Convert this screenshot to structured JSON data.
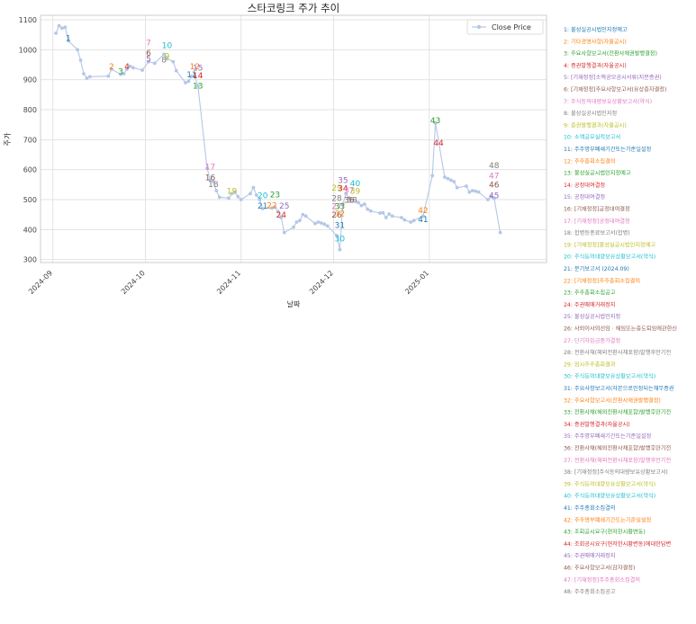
{
  "chart_data": {
    "type": "line",
    "title": "스타코링크 주가 추이",
    "xlabel": "날짜",
    "ylabel": "주가",
    "ylim": [
      290,
      1115
    ],
    "xlim": [
      "2024-08-28",
      "2025-02-08"
    ],
    "yticks": [
      300,
      400,
      500,
      600,
      700,
      800,
      900,
      1000,
      1100
    ],
    "xticks": [
      {
        "date": "2024-09-01",
        "label": "2024-09"
      },
      {
        "date": "2024-10-01",
        "label": "2024-10"
      },
      {
        "date": "2024-11-01",
        "label": "2024-11"
      },
      {
        "date": "2024-12-01",
        "label": "2024-12"
      },
      {
        "date": "2025-01-01",
        "label": "2025-01"
      }
    ],
    "grid": true,
    "legend": "top-right",
    "series": [
      {
        "name": "Close Price",
        "color": "#b4c7e7",
        "points": [
          [
            "2024-09-02",
            1055
          ],
          [
            "2024-09-03",
            1080
          ],
          [
            "2024-09-04",
            1072
          ],
          [
            "2024-09-05",
            1075
          ],
          [
            "2024-09-06",
            1030
          ],
          [
            "2024-09-09",
            1000
          ],
          [
            "2024-09-10",
            965
          ],
          [
            "2024-09-11",
            920
          ],
          [
            "2024-09-12",
            905
          ],
          [
            "2024-09-13",
            910
          ],
          [
            "2024-09-19",
            912
          ],
          [
            "2024-09-20",
            935
          ],
          [
            "2024-09-23",
            918
          ],
          [
            "2024-09-24",
            920
          ],
          [
            "2024-09-25",
            935
          ],
          [
            "2024-09-26",
            945
          ],
          [
            "2024-09-27",
            940
          ],
          [
            "2024-09-30",
            932
          ],
          [
            "2024-10-02",
            960
          ],
          [
            "2024-10-04",
            955
          ],
          [
            "2024-10-07",
            985
          ],
          [
            "2024-10-08",
            970
          ],
          [
            "2024-10-10",
            960
          ],
          [
            "2024-10-11",
            930
          ],
          [
            "2024-10-14",
            890
          ],
          [
            "2024-10-15",
            895
          ],
          [
            "2024-10-16",
            912
          ],
          [
            "2024-10-17",
            910
          ],
          [
            "2024-10-18",
            880
          ],
          [
            "2024-10-21",
            605
          ],
          [
            "2024-10-22",
            565
          ],
          [
            "2024-10-23",
            560
          ],
          [
            "2024-10-24",
            530
          ],
          [
            "2024-10-25",
            508
          ],
          [
            "2024-10-28",
            505
          ],
          [
            "2024-10-29",
            520
          ],
          [
            "2024-10-30",
            525
          ],
          [
            "2024-10-31",
            510
          ],
          [
            "2024-11-01",
            500
          ],
          [
            "2024-11-04",
            520
          ],
          [
            "2024-11-05",
            540
          ],
          [
            "2024-11-06",
            515
          ],
          [
            "2024-11-07",
            500
          ],
          [
            "2024-11-08",
            470
          ],
          [
            "2024-11-11",
            472
          ],
          [
            "2024-11-12",
            475
          ],
          [
            "2024-11-13",
            460
          ],
          [
            "2024-11-14",
            440
          ],
          [
            "2024-11-15",
            390
          ],
          [
            "2024-11-18",
            408
          ],
          [
            "2024-11-19",
            425
          ],
          [
            "2024-11-20",
            430
          ],
          [
            "2024-11-21",
            450
          ],
          [
            "2024-11-22",
            445
          ],
          [
            "2024-11-25",
            420
          ],
          [
            "2024-11-26",
            425
          ],
          [
            "2024-11-27",
            422
          ],
          [
            "2024-11-28",
            418
          ],
          [
            "2024-11-29",
            412
          ],
          [
            "2024-12-02",
            380
          ],
          [
            "2024-12-03",
            333
          ],
          [
            "2024-12-04",
            485
          ],
          [
            "2024-12-05",
            520
          ],
          [
            "2024-12-06",
            505
          ],
          [
            "2024-12-09",
            490
          ],
          [
            "2024-12-10",
            480
          ],
          [
            "2024-12-11",
            485
          ],
          [
            "2024-12-12",
            468
          ],
          [
            "2024-12-13",
            462
          ],
          [
            "2024-12-16",
            455
          ],
          [
            "2024-12-17",
            456
          ],
          [
            "2024-12-18",
            440
          ],
          [
            "2024-12-19",
            452
          ],
          [
            "2024-12-20",
            445
          ],
          [
            "2024-12-23",
            440
          ],
          [
            "2024-12-24",
            432
          ],
          [
            "2024-12-26",
            425
          ],
          [
            "2024-12-27",
            430
          ],
          [
            "2024-12-30",
            445
          ],
          [
            "2025-01-02",
            580
          ],
          [
            "2025-01-03",
            755
          ],
          [
            "2025-01-06",
            575
          ],
          [
            "2025-01-07",
            570
          ],
          [
            "2025-01-08",
            565
          ],
          [
            "2025-01-09",
            560
          ],
          [
            "2025-01-10",
            540
          ],
          [
            "2025-01-13",
            545
          ],
          [
            "2025-01-14",
            525
          ],
          [
            "2025-01-15",
            530
          ],
          [
            "2025-01-16",
            528
          ],
          [
            "2025-01-17",
            525
          ],
          [
            "2025-01-20",
            500
          ],
          [
            "2025-01-21",
            510
          ],
          [
            "2025-01-22",
            505
          ],
          [
            "2025-01-24",
            390
          ]
        ]
      }
    ],
    "annotations": [
      {
        "n": "1",
        "date": "2024-09-06",
        "y": 1030
      },
      {
        "n": "2",
        "date": "2024-09-20",
        "y": 935
      },
      {
        "n": "3",
        "date": "2024-09-23",
        "y": 918
      },
      {
        "n": "4",
        "date": "2024-09-25",
        "y": 935
      },
      {
        "n": "5",
        "date": "2024-10-02",
        "y": 960
      },
      {
        "n": "6",
        "date": "2024-10-02",
        "y": 980
      },
      {
        "n": "7",
        "date": "2024-10-02",
        "y": 1015
      },
      {
        "n": "8",
        "date": "2024-10-07",
        "y": 958
      },
      {
        "n": "9",
        "date": "2024-10-08",
        "y": 970
      },
      {
        "n": "10",
        "date": "2024-10-08",
        "y": 1005
      },
      {
        "n": "11",
        "date": "2024-10-16",
        "y": 908
      },
      {
        "n": "12",
        "date": "2024-10-17",
        "y": 935
      },
      {
        "n": "13",
        "date": "2024-10-18",
        "y": 870
      },
      {
        "n": "14",
        "date": "2024-10-18",
        "y": 905
      },
      {
        "n": "15",
        "date": "2024-10-18",
        "y": 930
      },
      {
        "n": "16",
        "date": "2024-10-22",
        "y": 565
      },
      {
        "n": "17",
        "date": "2024-10-22",
        "y": 600
      },
      {
        "n": "18",
        "date": "2024-10-23",
        "y": 542
      },
      {
        "n": "19",
        "date": "2024-10-29",
        "y": 520
      },
      {
        "n": "20",
        "date": "2024-11-08",
        "y": 505
      },
      {
        "n": "21",
        "date": "2024-11-08",
        "y": 470
      },
      {
        "n": "22",
        "date": "2024-11-11",
        "y": 472
      },
      {
        "n": "23",
        "date": "2024-11-12",
        "y": 508
      },
      {
        "n": "24",
        "date": "2024-11-14",
        "y": 440
      },
      {
        "n": "25",
        "date": "2024-11-15",
        "y": 470
      },
      {
        "n": "26",
        "date": "2024-12-02",
        "y": 440
      },
      {
        "n": "27",
        "date": "2024-12-02",
        "y": 468
      },
      {
        "n": "28",
        "date": "2024-12-02",
        "y": 495
      },
      {
        "n": "29",
        "date": "2024-12-02",
        "y": 530
      },
      {
        "n": "30",
        "date": "2024-12-03",
        "y": 360
      },
      {
        "n": "31",
        "date": "2024-12-03",
        "y": 405
      },
      {
        "n": "32",
        "date": "2024-12-03",
        "y": 445
      },
      {
        "n": "33",
        "date": "2024-12-03",
        "y": 468
      },
      {
        "n": "34",
        "date": "2024-12-04",
        "y": 528
      },
      {
        "n": "35",
        "date": "2024-12-04",
        "y": 555
      },
      {
        "n": "36",
        "date": "2024-12-06",
        "y": 490
      },
      {
        "n": "37",
        "date": "2024-12-06",
        "y": 522
      },
      {
        "n": "38",
        "date": "2024-12-07",
        "y": 490
      },
      {
        "n": "39",
        "date": "2024-12-08",
        "y": 520
      },
      {
        "n": "40",
        "date": "2024-12-08",
        "y": 545
      },
      {
        "n": "41",
        "date": "2024-12-30",
        "y": 425
      },
      {
        "n": "42",
        "date": "2024-12-30",
        "y": 455
      },
      {
        "n": "43",
        "date": "2025-01-03",
        "y": 755
      },
      {
        "n": "44",
        "date": "2025-01-04",
        "y": 680
      },
      {
        "n": "45",
        "date": "2025-01-22",
        "y": 505
      },
      {
        "n": "46",
        "date": "2025-01-22",
        "y": 540
      },
      {
        "n": "47",
        "date": "2025-01-22",
        "y": 570
      },
      {
        "n": "48",
        "date": "2025-01-22",
        "y": 605
      }
    ],
    "annotation_colors": [
      "#1f77b4",
      "#ff7f0e",
      "#2ca02c",
      "#d62728",
      "#9467bd",
      "#8c564b",
      "#e377c2",
      "#7f7f7f",
      "#bcbd22",
      "#17becf"
    ],
    "notes": [
      "1: 불성실공시법인지정예고",
      "2: 기타경영사항(자율공시)",
      "3: 주요사항보고서(전환사채권발행결정)",
      "4: 증권발행결과(자율공시)",
      "5: [기재정정]소액공모공시서류(지분증권)",
      "6: [기재정정]주요사항보고서(유상증자결정)",
      "7: 주식등의대량보유상황보고서(약식)",
      "8: 불성실공시법인지정",
      "9: 증권발행결과(자율공시)",
      "10: 소액공모실적보고서",
      "11: 주주명부폐쇄기간또는기준일설정",
      "12: 주주총회소집결의",
      "13: 불성실공시법인지정예고",
      "14: 공정대여결정",
      "15: 공정대여결정",
      "16: [기재정정]공정대여결정",
      "17: [기재정정]공정대여결정",
      "18: 합병등종료보고서(합병)",
      "19: [기재정정]불성실공시법인지정예고",
      "20: 주식등의대량보유상황보고서(약식)",
      "21: 분기보고서 (2024.09)",
      "22: [기재정정]주주총회소집결의",
      "23: 주주총회소집공고",
      "24: 주권매매거래정지",
      "25: 불성실공시법인지정",
      "26: 사외이사의선임 · 해임또는중도퇴임에관한신",
      "27: 단기차입금증가결정",
      "28: 전환사채(해외전환사채포함)발행후만기전",
      "29: 임시주주총회결과",
      "30: 주식등의대량보유상황보고서(약식)",
      "31: 주요사항보고서(자본으로인정되는채무증권",
      "32: 주요사항보고서(전환사채권발행결정)",
      "33: 전환사채(해외전환사채포함)발행후만기전",
      "34: 증권발행결과(자율공시)",
      "35: 주주명부폐쇄기간또는기준일설정",
      "36: 전환사채(해외전환사채포함)발행후만기전",
      "37: 전환사채(해외전환사채포함)발행후만기전",
      "38: [기재정정]주식등의대량보유상황보고서(",
      "39: 주식등의대량보유상황보고서(약식)",
      "40: 주식등의대량보유상황보고서(약식)",
      "41: 주주총회소집결의",
      "42: 주주명부폐쇄기간또는기준일설정",
      "43: 조회공시요구(현저한시황변동)",
      "44: 조회공시요구(현저한시황변동)에대한답변",
      "45: 주권매매거래정지",
      "46: 주요사항보고서(감자결정)",
      "47: [기재정정]주주총회소집결의",
      "48: 주주총회소집공고"
    ]
  }
}
